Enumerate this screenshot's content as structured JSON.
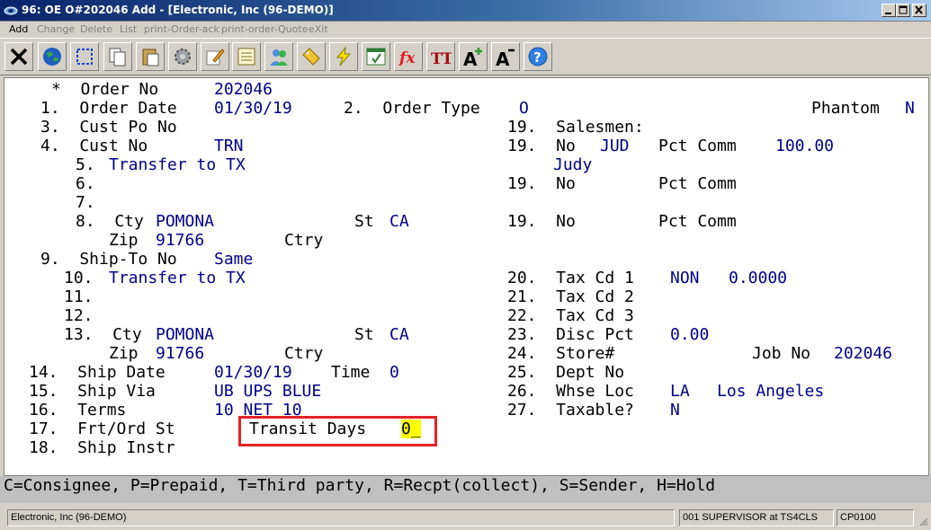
{
  "window": {
    "title": "96: OE O#202046   Add - [Electronic, Inc (96-DEMO)]"
  },
  "menu": {
    "items": [
      {
        "label": "Add",
        "enabled": true
      },
      {
        "label": "Change",
        "enabled": false
      },
      {
        "label": "Delete",
        "enabled": false
      },
      {
        "label": "List",
        "enabled": false
      },
      {
        "label": "print-Order-ack",
        "enabled": false
      },
      {
        "label": "print-order-Quote",
        "enabled": false
      },
      {
        "label": "eXit",
        "enabled": false
      }
    ]
  },
  "toolbar": {
    "icons": [
      "close-icon",
      "globe-icon",
      "select-icon",
      "copy-icon",
      "paste-icon",
      "settings-icon",
      "edit-icon",
      "notes-icon",
      "users-icon",
      "tag-icon",
      "lightning-icon",
      "spreadsheet-icon",
      "fx-icon",
      "font-size-icon",
      "font-increase-icon",
      "font-decrease-icon",
      "help-icon"
    ],
    "fx_label": "fx",
    "tt_label": "TT",
    "a_plus_label": "A",
    "a_minus_label": "A",
    "help_label": "?"
  },
  "form": {
    "order_no_label": "*  Order No",
    "order_no": "202046",
    "f1_label": "1.  Order Date",
    "order_date": "01/30/19",
    "f2_label": "2.  Order Type",
    "order_type": "O",
    "phantom_label": "Phantom",
    "phantom": "N",
    "f3_label": "3.  Cust Po No",
    "f4_label": "4.  Cust No",
    "cust_no": "TRN",
    "f5_label": "5.",
    "f5_value": "Transfer to TX",
    "f6_label": "6.",
    "f7_label": "7.",
    "f8_label": "8.  Cty",
    "f8_city": "POMONA",
    "st_label": "St",
    "f8_state": "CA",
    "zip_label": "Zip",
    "f8_zip": "91766",
    "ctry_label": "Ctry",
    "f9_label": "9.  Ship-To No",
    "ship_to_no": "Same",
    "f10_label": "10.",
    "f10_value": "Transfer to TX",
    "f11_label": "11.",
    "f12_label": "12.",
    "f13_label": "13.  Cty",
    "f13_city": "POMONA",
    "f13_state": "CA",
    "f13_zip": "91766",
    "f14_label": "14.  Ship Date",
    "ship_date": "01/30/19",
    "time_label": "Time",
    "time_value": "0",
    "f15_label": "15.  Ship Via",
    "ship_via": "UB UPS BLUE",
    "f16_label": "16.  Terms",
    "terms": "10 NET 10",
    "f17_label": "17.  Frt/Ord St",
    "transit_days_label": "Transit Days",
    "transit_days": "0_",
    "f18_label": "18.  Ship Instr",
    "f19_salesmen_label": "19.  Salesmen:",
    "f19_no_label": "19.  No",
    "salesman1_no": "JUD",
    "pct_comm_label": "Pct Comm",
    "salesman1_pct": "100.00",
    "salesman1_name": "Judy",
    "f20_label": "20.  Tax Cd 1",
    "tax_cd1": "NON",
    "tax_cd1_rate": "0.0000",
    "f21_label": "21.  Tax Cd 2",
    "f22_label": "22.  Tax Cd 3",
    "f23_label": "23.  Disc Pct",
    "disc_pct": "0.00",
    "f24_label": "24.  Store#",
    "job_no_label": "Job No",
    "job_no": "202046",
    "f25_label": "25.  Dept No",
    "f26_label": "26.  Whse Loc",
    "whse_loc": "LA",
    "whse_name": "Los Angeles",
    "f27_label": "27.  Taxable?",
    "taxable": "N"
  },
  "help_line": "C=Consignee, P=Prepaid, T=Third party, R=Recpt(collect), S=Sender, H=Hold",
  "status": {
    "company": "Electronic, Inc (96-DEMO)",
    "user": "001 SUPERVISOR at TS4CLS",
    "code": "CP0100"
  },
  "colors": {
    "field_value": "#00008b",
    "highlight_border": "#e32228",
    "cursor_bg": "#ffff00"
  }
}
